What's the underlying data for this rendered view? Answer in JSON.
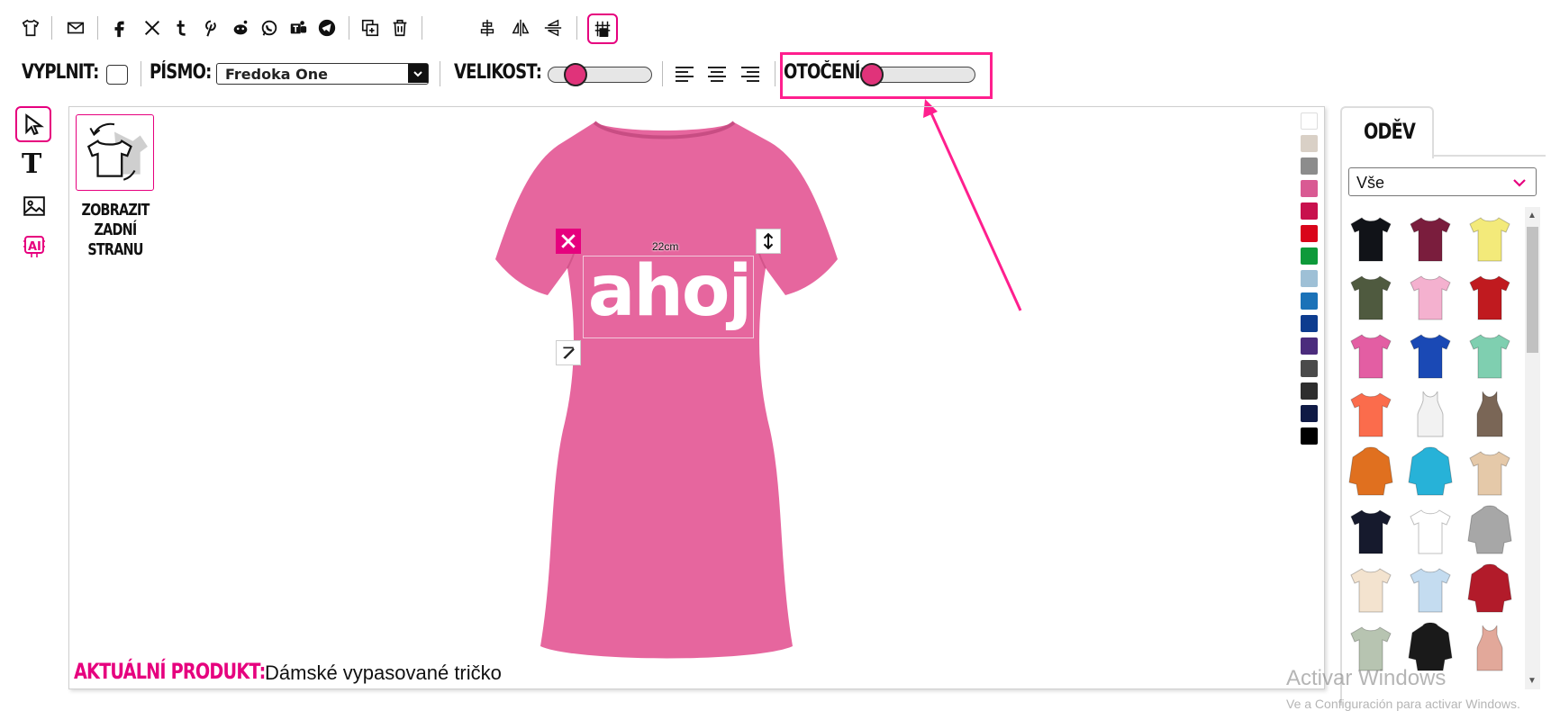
{
  "toolbar": {
    "fill_label": "VYPLNIT:",
    "font_label": "PÍSMO:",
    "font_value": "Fredoka One",
    "size_label": "VELIKOST:",
    "rotation_label": "OTOČENÍ:",
    "size_value": 0.2,
    "rotation_value": 0.0
  },
  "side_tools": {
    "back_side_line1": "ZOBRAZIT",
    "back_side_line2": "ZADNÍ",
    "back_side_line3": "STRANU"
  },
  "canvas": {
    "design_text": "ahoj",
    "width_readout": "22cm",
    "product_label": "AKTUÁLNÍ PRODUKT:",
    "product_name": "Dámské vypasované tričko",
    "shirt_color": "#e6669e"
  },
  "colors": [
    "#ffffff",
    "#d9d0c6",
    "#8c8c8c",
    "#d95a93",
    "#c8104d",
    "#d9041a",
    "#0e9a3a",
    "#9ec0d6",
    "#1b72b8",
    "#0d3c8f",
    "#4b2c7d",
    "#4a4a4a",
    "#2e2e2e",
    "#0f1a45",
    "#000000"
  ],
  "panel": {
    "tab_label": "ODĚV",
    "filter_value": "Vše"
  },
  "products": [
    {
      "name": "black-tshirt",
      "color": "#111318"
    },
    {
      "name": "maroon-tshirt",
      "color": "#7a1d3d"
    },
    {
      "name": "yellow-tshirt",
      "color": "#f3ea7a"
    },
    {
      "name": "olive-tshirt",
      "color": "#4f5a3f"
    },
    {
      "name": "pink-tshirt",
      "color": "#f4b1cf"
    },
    {
      "name": "red-tshirt",
      "color": "#c01a1f"
    },
    {
      "name": "fuchsia-tshirt",
      "color": "#e35ea3"
    },
    {
      "name": "royal-tshirt",
      "color": "#1a49b5"
    },
    {
      "name": "mint-tshirt",
      "color": "#7fcfb0"
    },
    {
      "name": "coral-tshirt",
      "color": "#fb6c4c"
    },
    {
      "name": "white-tank",
      "color": "#f2f2f2"
    },
    {
      "name": "brown-tank",
      "color": "#7a6656"
    },
    {
      "name": "orange-hoodie",
      "color": "#e0701f"
    },
    {
      "name": "turquoise-hoodie",
      "color": "#27b2d8"
    },
    {
      "name": "tie-dye-tshirt",
      "color": "#e5c9a9"
    },
    {
      "name": "navy-tshirt",
      "color": "#161a2d"
    },
    {
      "name": "raglan-tshirt",
      "color": "#ffffff"
    },
    {
      "name": "grey-hoodie",
      "color": "#a7a7a7"
    },
    {
      "name": "cream-tshirt",
      "color": "#f3e3cf"
    },
    {
      "name": "lightblue-tshirt",
      "color": "#c4dcf0"
    },
    {
      "name": "varsity-jacket",
      "color": "#b21b2a"
    },
    {
      "name": "sage-longsleeve",
      "color": "#b7c4b1"
    },
    {
      "name": "black-orange-hoodie",
      "color": "#1a1a1a"
    },
    {
      "name": "peach-tank",
      "color": "#e2a89a"
    }
  ],
  "watermark": {
    "line1": "Activar Windows",
    "line2": "Ve a Configuración para activar Windows."
  },
  "accent": "#e6007e"
}
